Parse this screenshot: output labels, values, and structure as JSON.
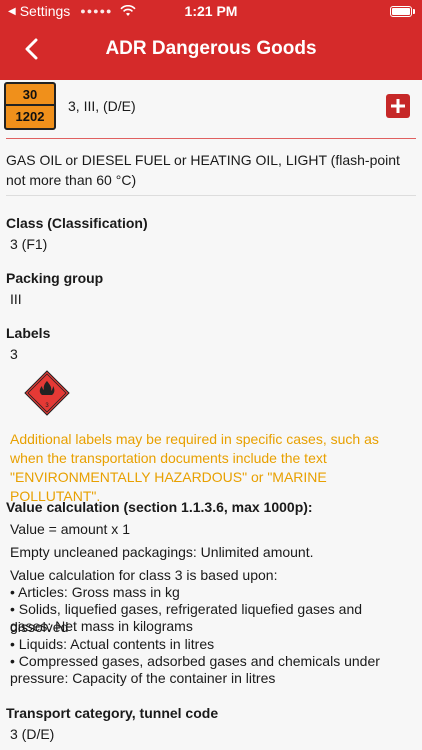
{
  "status": {
    "carrier": "Settings",
    "time": "1:21 PM"
  },
  "nav": {
    "title": "ADR Dangerous Goods"
  },
  "entry": {
    "hazard_number": "30",
    "un_number": "1202",
    "summary": "3, III, (D/E)",
    "name": "GAS OIL or DIESEL FUEL or HEATING OIL, LIGHT (flash-point not more than 60 °C)"
  },
  "sections": {
    "class_title": "Class (Classification)",
    "class_value": "3 (F1)",
    "packing_title": "Packing group",
    "packing_value": "III",
    "labels_title": "Labels",
    "labels_value": "3",
    "labels_note": "Additional labels may be required in specific cases, such as when the transportation documents include the text \"ENVIRONMENTALLY HAZARDOUS\" or \"MARINE POLLUTANT\".",
    "value_calc_title": "Value calculation (section 1.1.3.6, max 1000p):",
    "value_formula": "Value = amount x 1",
    "empty_packagings": "Empty uncleaned packagings: Unlimited amount.",
    "calc_basis_lines": [
      "Value calculation for class 3 is based upon:",
      "• Articles: Gross mass in kg",
      "• Solids, liquefied gases, refrigerated liquefied gases and dissolved",
      "gases: Net mass in kilograms",
      "• Liquids: Actual contents in litres",
      "• Compressed gases, adsorbed gases and chemicals under",
      "pressure: Capacity of the container in litres"
    ],
    "transport_title": "Transport category, tunnel code",
    "transport_value": "3 (D/E)"
  },
  "colors": {
    "header": "#d52a2a",
    "plate": "#f0901b",
    "warning": "#e8a000"
  }
}
